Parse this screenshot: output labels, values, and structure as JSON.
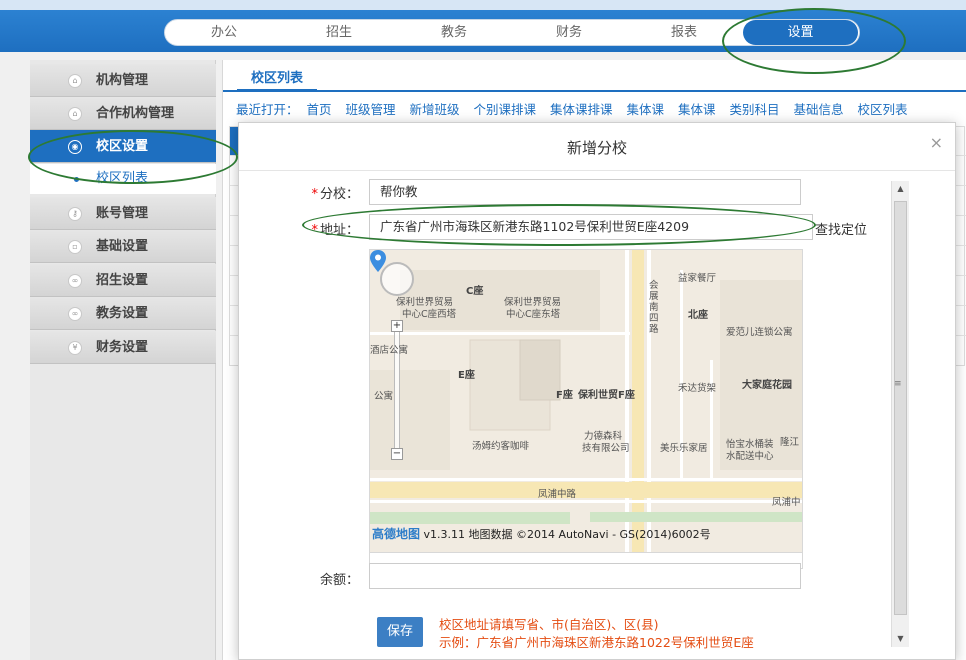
{
  "nav": {
    "items": [
      "办公",
      "招生",
      "教务",
      "财务",
      "报表",
      "设置"
    ],
    "active": "设置"
  },
  "sidebar": {
    "items": [
      {
        "label": "机构管理",
        "icon": "home-icon"
      },
      {
        "label": "合作机构管理",
        "icon": "home-icon"
      },
      {
        "label": "校区设置",
        "icon": "target-icon",
        "active": true
      },
      {
        "label": "账号管理",
        "icon": "key-icon"
      },
      {
        "label": "基础设置",
        "icon": "document-icon"
      },
      {
        "label": "招生设置",
        "icon": "link-icon"
      },
      {
        "label": "教务设置",
        "icon": "link-icon"
      },
      {
        "label": "财务设置",
        "icon": "yen-icon"
      }
    ],
    "sub_item": "校区列表"
  },
  "main": {
    "tab": "校区列表",
    "recent_label": "最近打开：",
    "recent_links": [
      "首页",
      "班级管理",
      "新增班级",
      "个别课排课",
      "集体课排课",
      "集体课",
      "集体课",
      "类别科目",
      "基础信息",
      "校区列表"
    ]
  },
  "modal": {
    "title": "新增分校",
    "close": "×",
    "branch_label": "分校",
    "branch_value": "帮你教",
    "address_label": "地址",
    "address_value": "广东省广州市海珠区新港东路1102号保利世贸E座4209",
    "find_label": "查找定位",
    "balance_label": "余额",
    "balance_value": "",
    "required_mark": "*",
    "save_label": "保存",
    "hint_line1": "校区地址请填写省、市(自治区)、区(县)",
    "hint_line2": "示例：广东省广州市海珠区新港东路1022号保利世贸E座"
  },
  "map": {
    "labels": {
      "restaurant": "益家餐厅",
      "c_building": "C座",
      "poly_west_1": "保利世界贸易",
      "poly_west_2": "中心C座西塔",
      "poly_east_1": "保利世界贸易",
      "poly_east_2": "中心C座东塔",
      "north": "北座",
      "kids_1": "爱范儿连锁公寓",
      "hotel": "酒店公寓",
      "e_building": "E座",
      "f_building": "F座",
      "poly_f": "保利世贸F座",
      "apartment": "公寓",
      "heda": "禾达货架",
      "dajia": "大家庭花园",
      "coffee": "汤姆约客咖啡",
      "lide_1": "力德森科",
      "lide_2": "技有限公司",
      "meile": "美乐乐家居",
      "water_1": "怡宝水桶装",
      "water_2": "水配送中心",
      "longjiang": "隆江",
      "road_1": "凤浦中路",
      "road_2": "凤浦中",
      "road_vertical": "会展南四路",
      "copyright_brand": "高德地图",
      "copyright": "v1.3.11 地图数据 ©2014 AutoNavi - GS(2014)6002号"
    }
  },
  "colors": {
    "primary": "#1e6fc0",
    "hint": "#e44d13",
    "annotation": "#2d7a33"
  }
}
